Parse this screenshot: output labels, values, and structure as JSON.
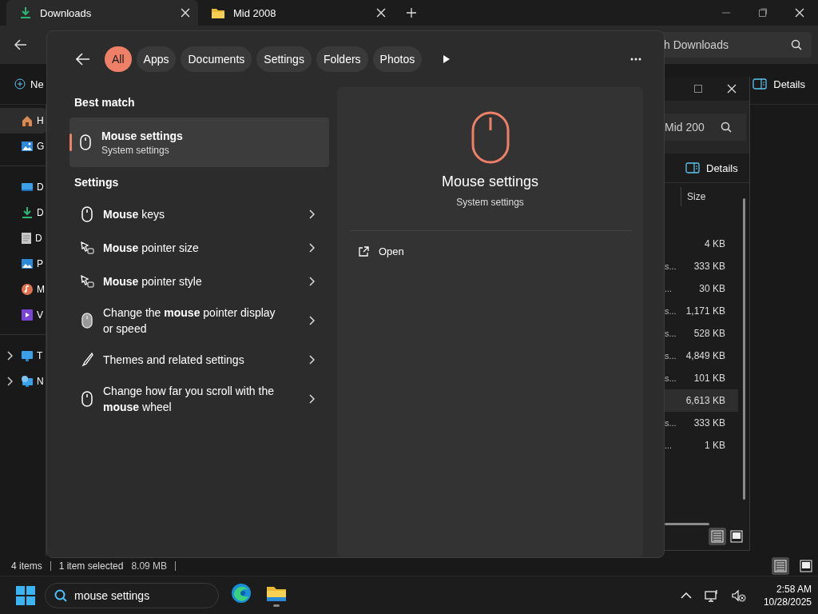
{
  "explorer": {
    "tabs": [
      {
        "label": "Downloads",
        "selected": true
      },
      {
        "label": "Mid 2008",
        "selected": false
      }
    ],
    "search": {
      "placeholder": "h Downloads"
    },
    "command_bar": {
      "new_label": "Ne",
      "details_label": "Details"
    },
    "sidebar": {
      "sections": [
        {
          "items": [
            {
              "label": "H",
              "selected": true
            },
            {
              "label": "G",
              "selected": false
            }
          ]
        },
        {
          "items": [
            {
              "label": "D",
              "selected": false
            },
            {
              "label": "D",
              "selected": false
            },
            {
              "label": "D",
              "selected": false
            },
            {
              "label": "P",
              "selected": false
            },
            {
              "label": "M",
              "selected": false
            },
            {
              "label": "V",
              "selected": false
            }
          ]
        },
        {
          "items": [
            {
              "label": "T",
              "selected": false,
              "expanded": false
            },
            {
              "label": "N",
              "selected": false,
              "expanded": false
            }
          ]
        }
      ]
    },
    "status_bar": {
      "items": "4 items",
      "selection": "1 item selected",
      "size": "8.09 MB"
    },
    "view_buttons": [
      {
        "kind": "details",
        "selected": true
      },
      {
        "kind": "tiles",
        "selected": false
      }
    ]
  },
  "second_window": {
    "search": {
      "placeholder": "Mid 200"
    },
    "details_label": "Details",
    "columns": [
      "Size"
    ],
    "rows": [
      {
        "size": "4 KB",
        "selected": false
      },
      {
        "name_tail": "s...",
        "size": "333 KB",
        "selected": false
      },
      {
        "name_tail": "...",
        "size": "30 KB",
        "selected": false
      },
      {
        "name_tail": "s...",
        "size": "1,171 KB",
        "selected": false
      },
      {
        "name_tail": "s...",
        "size": "528 KB",
        "selected": false
      },
      {
        "name_tail": "s...",
        "size": "4,849 KB",
        "selected": false
      },
      {
        "name_tail": "s...",
        "size": "101 KB",
        "selected": false
      },
      {
        "size": "6,613 KB",
        "selected": true
      },
      {
        "name_tail": "s...",
        "size": "333 KB",
        "selected": false
      },
      {
        "name_tail": "...",
        "size": "1 KB",
        "selected": false
      }
    ],
    "view_buttons": [
      {
        "kind": "details",
        "selected": true
      },
      {
        "kind": "tiles",
        "selected": false
      }
    ]
  },
  "search_panel": {
    "filters": [
      {
        "label": "All",
        "selected": true
      },
      {
        "label": "Apps",
        "selected": false
      },
      {
        "label": "Documents",
        "selected": false
      },
      {
        "label": "Settings",
        "selected": false
      },
      {
        "label": "Folders",
        "selected": false
      },
      {
        "label": "Photos",
        "selected": false
      }
    ],
    "best_match": {
      "heading": "Best match",
      "title": "Mouse settings",
      "subtitle": "System settings",
      "selected": true
    },
    "settings": {
      "heading": "Settings",
      "items": [
        {
          "text": "**Mouse** keys"
        },
        {
          "text": "**Mouse** pointer size"
        },
        {
          "text": "**Mouse** pointer style"
        },
        {
          "text": "Change the **mouse** pointer display or speed"
        },
        {
          "text": "Themes and related settings"
        },
        {
          "text": "Change how far you scroll with the **mouse** wheel"
        }
      ]
    },
    "preview": {
      "title": "Mouse settings",
      "subtitle": "System settings",
      "action": "Open"
    }
  },
  "taskbar": {
    "search": {
      "value": "mouse settings"
    },
    "apps": [
      {
        "running": false
      },
      {
        "running": true
      }
    ],
    "time": "2:58 AM",
    "date": "10/28/2025"
  }
}
